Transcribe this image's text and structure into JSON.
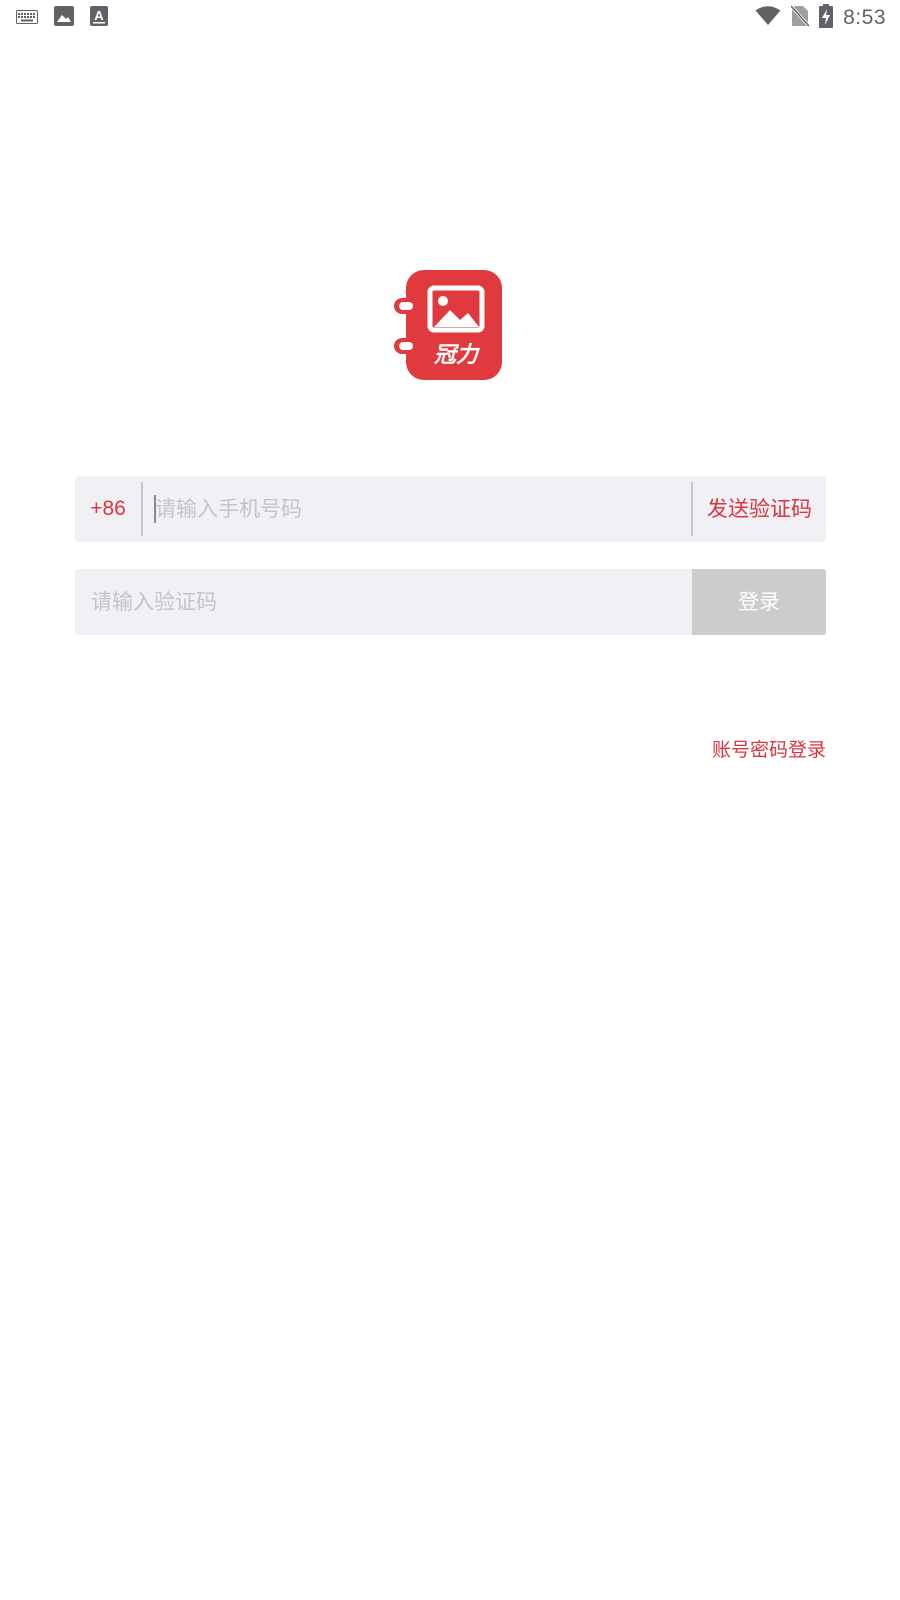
{
  "status_bar": {
    "time": "8:53",
    "left_icons": [
      "keyboard-icon",
      "image-icon",
      "text-a-icon"
    ],
    "right_icons": [
      "wifi-icon",
      "no-sim-icon",
      "battery-charging-icon"
    ]
  },
  "logo": {
    "text": "冠力",
    "color": "#e0393e"
  },
  "phone_row": {
    "country_code": "+86",
    "placeholder": "请输入手机号码",
    "value": "",
    "send_code_label": "发送验证码"
  },
  "code_row": {
    "placeholder": "请输入验证码",
    "value": "",
    "login_label": "登录"
  },
  "alt_login": {
    "label": "账号密码登录"
  },
  "colors": {
    "accent": "#d9363e",
    "field_bg": "#f1f0f5",
    "login_disabled_bg": "#cccccc"
  }
}
